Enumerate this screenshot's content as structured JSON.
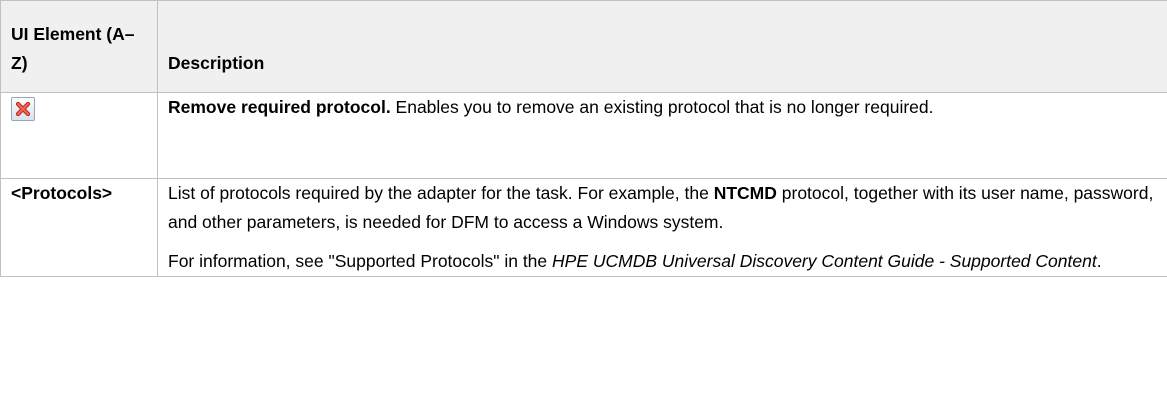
{
  "table": {
    "headers": {
      "element": "UI Element (A–Z)",
      "description": "Description"
    },
    "rows": [
      {
        "element_icon": "remove-icon",
        "description": {
          "bold": "Remove required protocol.",
          "text": " Enables you to remove an existing protocol that is no longer required."
        }
      },
      {
        "element": "<Protocols>",
        "description": {
          "p1_before": "List of protocols required by the adapter for the task. For example, the ",
          "p1_bold": "NTCMD",
          "p1_after": " protocol, together with its user name, password, and other parameters, is needed for DFM to access a Windows system.",
          "p2_before": "For information, see \"Supported Protocols\" in the ",
          "p2_italic": "HPE UCMDB Universal Discovery Content Guide - Supported Content",
          "p2_after": "."
        }
      }
    ]
  },
  "colors": {
    "header_bg": "#f0f0f0",
    "border": "#c0c0c0",
    "icon_x": "#e0412f"
  }
}
